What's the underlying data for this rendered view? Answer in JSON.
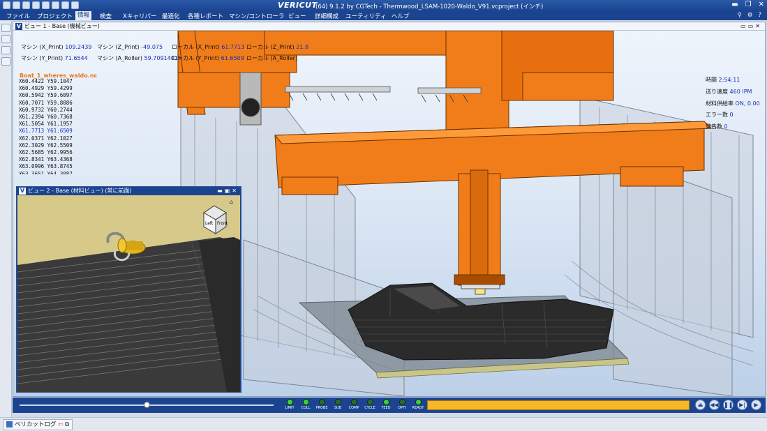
{
  "app": {
    "brand": "VERICUT",
    "title": "(64)  9.1.2 by CGTech - Thermwood_LSAM-1020-Waldo_V91.vcproject (インチ)"
  },
  "menu": [
    "ファイル",
    "プロジェクト",
    "情報",
    "検査",
    "Xキャリパー",
    "最適化",
    "各種レポート",
    "マシン/コントローラ",
    "ビュー",
    "詳細構成",
    "ユーティリティ",
    "ヘルプ"
  ],
  "menu_active": "情報",
  "view1": {
    "title": "ビュー 1 - Base (機械ビュー)",
    "readouts": {
      "x_print_label": "マシン (X_Print)",
      "x_print_value": "109.2439",
      "z_print_label": "マシン (Z_Print)",
      "z_print_value": "-49.075",
      "local_x_label": "ローカル (X_Print)",
      "local_x_value": "61.7713",
      "local_z_label": "ローカル (Z_Print)",
      "local_z_value": "21.8",
      "y_print_label": "マシン (Y_Print)",
      "y_print_value": "71.6544",
      "a_roller_label": "マシン (A_Roller)",
      "a_roller_value": "59.70914015",
      "local_y_label": "ローカル (Y_Print)",
      "local_y_value": "61.6509",
      "local_a_label": "ローカル (A_Roller)",
      "local_a_value": ""
    },
    "nc_file": "Boat_1_wheres_waldo.nc",
    "nc_lines": [
      "X60.4422 Y59.1047",
      "X60.4929 Y59.4299",
      "X60.5942 Y59.6097",
      "X60.7071 Y59.8086",
      "X60.9732 Y60.2744",
      "X61.2394 Y60.7368",
      "X61.5054 Y61.1957",
      "X61.7713 Y61.6509",
      "X62.0371 Y62.1027",
      "X62.3029 Y62.5509",
      "X62.5685 Y62.9956",
      "X62.8341 Y63.4368",
      "X63.0996 Y63.8745",
      "X63.3651 Y64.3087",
      "X63.6304 Y64.7394"
    ],
    "nc_current_index": 7,
    "stats": {
      "time_label": "時間",
      "time_value": "2:54:11",
      "feed_label": "送り速度",
      "feed_value": "460 IPM",
      "material_label": "材料供給率",
      "material_value": "ON, 0.00",
      "errors_label": "エラー数",
      "errors_value": "0",
      "warnings_label": "警告数",
      "warnings_value": "0"
    }
  },
  "view2": {
    "title": "ビュー 2 - Base (材料ビュー) (常に前面)",
    "cube_left": "Left",
    "cube_front": "Front"
  },
  "playback": {
    "slider_value": 0.5,
    "leds": [
      {
        "label": "LIMIT",
        "on": true
      },
      {
        "label": "COLL",
        "on": true
      },
      {
        "label": "PROBE",
        "on": false
      },
      {
        "label": "SUB",
        "on": false
      },
      {
        "label": "COMP",
        "on": false
      },
      {
        "label": "CYCLE",
        "on": false
      },
      {
        "label": "FEED",
        "on": true
      },
      {
        "label": "OPTI",
        "on": false
      },
      {
        "label": "READY",
        "on": true
      }
    ],
    "progress_color": "#f7b727"
  },
  "statusbar": {
    "log_label": "ベリカットログ"
  },
  "colors": {
    "accent": "#1b4490",
    "machine_orange": "#f07d1a",
    "value_blue": "#1a2fb8",
    "nc_file_orange": "#e8761c"
  }
}
